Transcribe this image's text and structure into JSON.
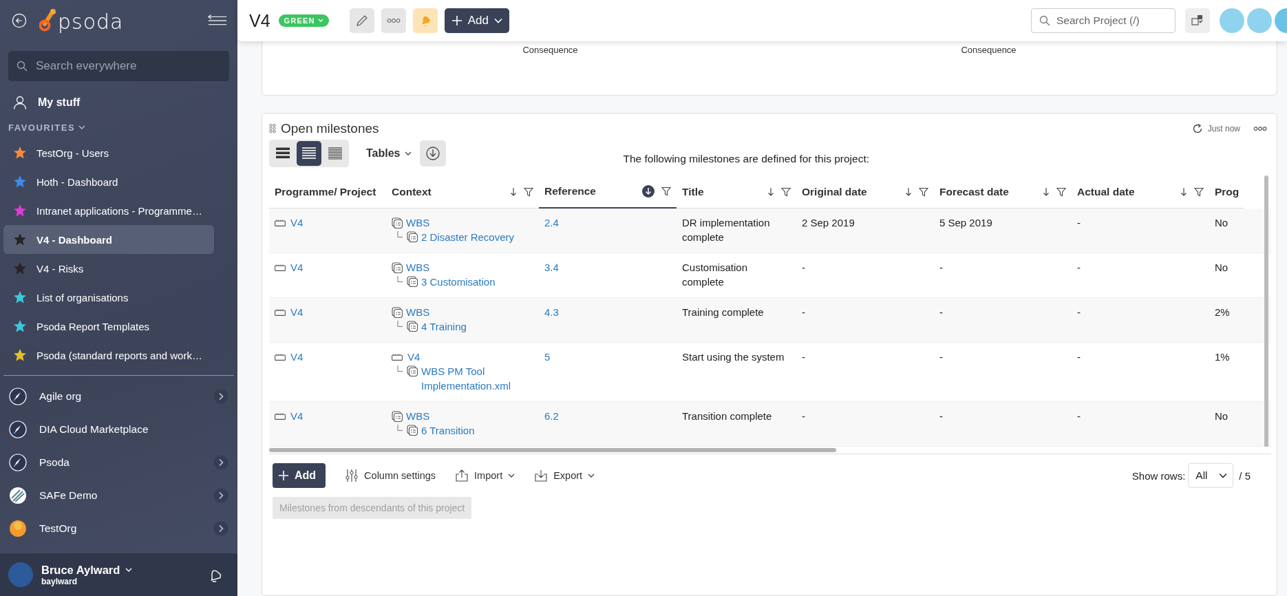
{
  "sidebar": {
    "logo": "psoda",
    "search": {
      "placeholder": "Search everywhere"
    },
    "my_stuff": "My stuff",
    "favourites_heading": "FAVOURITES",
    "favourites": [
      {
        "label": "TestOrg - Users",
        "color": "#f58a3a",
        "selected": false
      },
      {
        "label": "Hoth - Dashboard",
        "color": "#3b8be8",
        "selected": false
      },
      {
        "label": "Intranet applications - Programme…",
        "color": "#e23ad8",
        "selected": false
      },
      {
        "label": "V4 - Dashboard",
        "color": "#262626",
        "selected": true
      },
      {
        "label": "V4 - Risks",
        "color": "#262626",
        "selected": false
      },
      {
        "label": "List of organisations",
        "color": "#3cc8dc",
        "selected": false
      },
      {
        "label": "Psoda Report Templates",
        "color": "#3cc8dc",
        "selected": false
      },
      {
        "label": "Psoda (standard reports and work…",
        "color": "#e6c02a",
        "selected": false
      }
    ],
    "organisations": [
      {
        "label": "Agile org",
        "kind": "rocket",
        "expandable": true
      },
      {
        "label": "DIA Cloud Marketplace",
        "kind": "rocket",
        "expandable": false
      },
      {
        "label": "Psoda",
        "kind": "rocket",
        "expandable": true
      },
      {
        "label": "SAFe Demo",
        "kind": "stripes",
        "expandable": true
      },
      {
        "label": "TestOrg",
        "kind": "sunset",
        "expandable": true
      }
    ],
    "user": {
      "name": "Bruce Aylward",
      "username": "baylward"
    }
  },
  "topbar": {
    "title": "V4",
    "status": "GREEN",
    "add_button": "Add",
    "search": {
      "placeholder": "Search Project (/)"
    }
  },
  "risk_panel": {
    "axis_labels": [
      "Consequence",
      "Consequence"
    ]
  },
  "milestones": {
    "title": "Open milestones",
    "refreshed": "Just now",
    "views": [
      {
        "kind": "wide",
        "selected": false
      },
      {
        "kind": "normal",
        "selected": true
      },
      {
        "kind": "dense",
        "selected": false
      }
    ],
    "tables_menu": "Tables",
    "caption": "The following milestones are defined for this project:",
    "columns": [
      {
        "label": "Programme/ Project",
        "sorted": false
      },
      {
        "label": "Context",
        "sortable": true,
        "sorted": false
      },
      {
        "label": "Reference",
        "sortable": true,
        "sorted": true
      },
      {
        "label": "Title",
        "sortable": true,
        "sorted": false
      },
      {
        "label": "Original date",
        "sortable": true,
        "sorted": false
      },
      {
        "label": "Forecast date",
        "sortable": true,
        "sorted": false
      },
      {
        "label": "Actual date",
        "sortable": true,
        "sorted": false
      },
      {
        "label": "Prog",
        "sorted": false
      }
    ],
    "rows": [
      {
        "project": "V4",
        "context": {
          "label": "WBS",
          "kind": "wbs",
          "children": [
            {
              "label": "2 Disaster Recovery",
              "kind": "wbs"
            }
          ]
        },
        "reference": "2.4",
        "title": "DR implementation complete",
        "original_date": "2 Sep 2019",
        "forecast_date": "5 Sep 2019",
        "actual_date": "-",
        "column_8": "No"
      },
      {
        "project": "V4",
        "context": {
          "label": "WBS",
          "kind": "wbs",
          "children": [
            {
              "label": "3 Customisation",
              "kind": "wbs"
            }
          ]
        },
        "reference": "3.4",
        "title": "Customisation complete",
        "original_date": "-",
        "forecast_date": "-",
        "actual_date": "-",
        "column_8": "No"
      },
      {
        "project": "V4",
        "context": {
          "label": "WBS",
          "kind": "wbs",
          "children": [
            {
              "label": "4 Training",
              "kind": "wbs"
            }
          ]
        },
        "reference": "4.3",
        "title": "Training complete",
        "original_date": "-",
        "forecast_date": "-",
        "actual_date": "-",
        "column_8": "2%"
      },
      {
        "project": "V4",
        "context": {
          "label": "V4",
          "kind": "project",
          "children": [
            {
              "label": "WBS PM Tool Implementation.xml",
              "kind": "wbs"
            }
          ]
        },
        "reference": "5",
        "title": "Start using the system",
        "original_date": "-",
        "forecast_date": "-",
        "actual_date": "-",
        "column_8": "1%"
      },
      {
        "project": "V4",
        "context": {
          "label": "WBS",
          "kind": "wbs",
          "children": [
            {
              "label": "6 Transition",
              "kind": "wbs"
            }
          ]
        },
        "reference": "6.2",
        "title": "Transition complete",
        "original_date": "-",
        "forecast_date": "-",
        "actual_date": "-",
        "column_8": "No"
      }
    ],
    "footer": {
      "add": "Add",
      "column_settings": "Column settings",
      "import": "Import",
      "export": "Export",
      "show_rows_label": "Show rows:",
      "show_rows_value": "All",
      "total": "/ 5",
      "descendants_button": {
        "label": "Milestones from descendants of this project",
        "disabled": true
      }
    }
  }
}
